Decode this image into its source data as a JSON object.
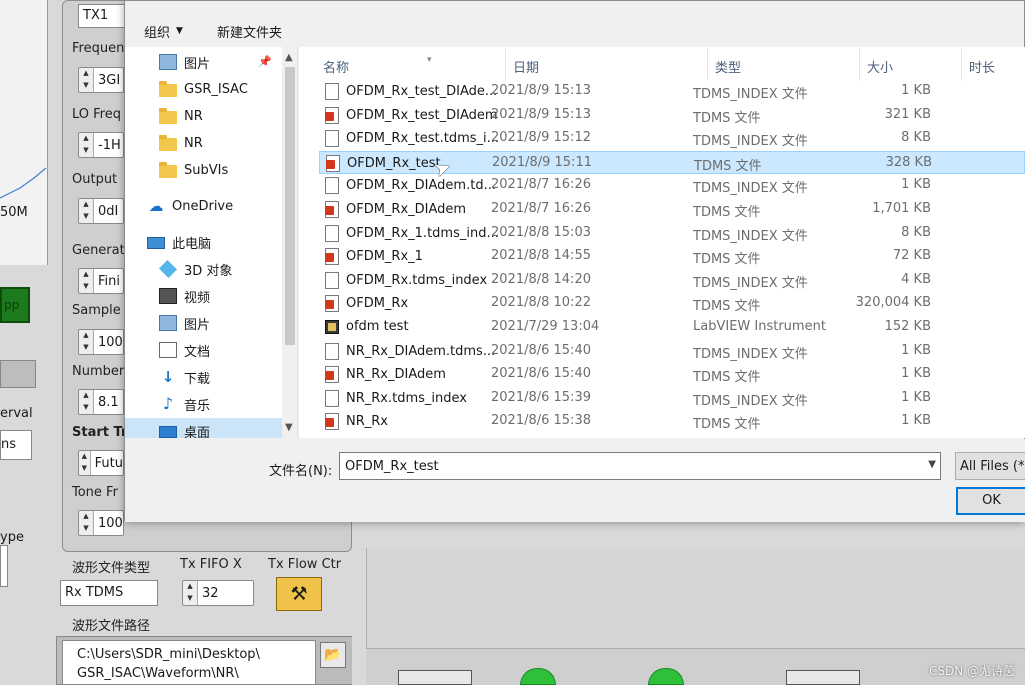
{
  "labview": {
    "freq_tick": "50M",
    "tx_value": "TX1",
    "labels": {
      "frequency": "Frequen",
      "lo_freq": "LO Freq",
      "output": "Output",
      "generate": "Generat",
      "sample": "Sample",
      "number": "Number",
      "start_tr": "Start Tr",
      "tone_fr": "Tone Fr",
      "interval": "erval",
      "type": "ype",
      "waveform_type": "波形文件类型",
      "tx_fifo": "Tx FIFO X",
      "tx_flow": "Tx Flow Ctr",
      "waveform_path": "波形文件路径"
    },
    "values": {
      "frequency": "3GI",
      "lo_freq": "-1H",
      "output": "0dI",
      "generate": "Fini",
      "sample": "100",
      "number": "8.1",
      "start_tr": "Futu",
      "tone_fr": "100",
      "ms": "ns",
      "waveform_type": "Rx TDMS",
      "tx_fifo": "32",
      "path_line1": "C:\\Users\\SDR_mini\\Desktop\\",
      "path_line2": "GSR_ISAC\\Waveform\\NR\\"
    },
    "green_label": "pp"
  },
  "dialog": {
    "toolbar": {
      "organize": "组织",
      "new_folder": "新建文件夹"
    },
    "nav": [
      {
        "label": "图片",
        "icon": "image-icon",
        "pinned": true
      },
      {
        "label": "GSR_ISAC",
        "icon": "folder-icon"
      },
      {
        "label": "NR",
        "icon": "folder-icon"
      },
      {
        "label": "NR",
        "icon": "folder-icon"
      },
      {
        "label": "SubVIs",
        "icon": "folder-icon"
      },
      {
        "label": "OneDrive",
        "icon": "cloud-icon"
      },
      {
        "label": "此电脑",
        "icon": "computer-icon"
      },
      {
        "label": "3D 对象",
        "icon": "3d-objects-icon"
      },
      {
        "label": "视频",
        "icon": "video-icon"
      },
      {
        "label": "图片",
        "icon": "image-icon"
      },
      {
        "label": "文档",
        "icon": "document-icon"
      },
      {
        "label": "下载",
        "icon": "download-icon"
      },
      {
        "label": "音乐",
        "icon": "music-icon"
      },
      {
        "label": "桌面",
        "icon": "desktop-icon"
      }
    ],
    "columns": {
      "name": "名称",
      "date": "日期",
      "type": "类型",
      "size": "大小",
      "duration": "时长"
    },
    "files": [
      {
        "name": "OFDM_Rx_test_DIAde...",
        "date": "2021/8/9 15:13",
        "type": "TDMS_INDEX 文件",
        "size": "1 KB",
        "icon": "index"
      },
      {
        "name": "OFDM_Rx_test_DIAdem",
        "date": "2021/8/9 15:13",
        "type": "TDMS 文件",
        "size": "321 KB",
        "icon": "tdms"
      },
      {
        "name": "OFDM_Rx_test.tdms_i...",
        "date": "2021/8/9 15:12",
        "type": "TDMS_INDEX 文件",
        "size": "8 KB",
        "icon": "index"
      },
      {
        "name": "OFDM_Rx_test",
        "date": "2021/8/9 15:11",
        "type": "TDMS 文件",
        "size": "328 KB",
        "icon": "tdms",
        "selected": true
      },
      {
        "name": "OFDM_Rx_DIAdem.td...",
        "date": "2021/8/7 16:26",
        "type": "TDMS_INDEX 文件",
        "size": "1 KB",
        "icon": "index"
      },
      {
        "name": "OFDM_Rx_DIAdem",
        "date": "2021/8/7 16:26",
        "type": "TDMS 文件",
        "size": "1,701 KB",
        "icon": "tdms"
      },
      {
        "name": "OFDM_Rx_1.tdms_ind...",
        "date": "2021/8/8 15:03",
        "type": "TDMS_INDEX 文件",
        "size": "8 KB",
        "icon": "index"
      },
      {
        "name": "OFDM_Rx_1",
        "date": "2021/8/8 14:55",
        "type": "TDMS 文件",
        "size": "72 KB",
        "icon": "tdms"
      },
      {
        "name": "OFDM_Rx.tdms_index",
        "date": "2021/8/8 14:20",
        "type": "TDMS_INDEX 文件",
        "size": "4 KB",
        "icon": "index"
      },
      {
        "name": "OFDM_Rx",
        "date": "2021/8/8 10:22",
        "type": "TDMS 文件",
        "size": "320,004 KB",
        "icon": "tdms"
      },
      {
        "name": "ofdm test",
        "date": "2021/7/29 13:04",
        "type": "LabVIEW Instrument",
        "size": "152 KB",
        "icon": "vi"
      },
      {
        "name": "NR_Rx_DIAdem.tdms...",
        "date": "2021/8/6 15:40",
        "type": "TDMS_INDEX 文件",
        "size": "1 KB",
        "icon": "index"
      },
      {
        "name": "NR_Rx_DIAdem",
        "date": "2021/8/6 15:40",
        "type": "TDMS 文件",
        "size": "1 KB",
        "icon": "tdms"
      },
      {
        "name": "NR_Rx.tdms_index",
        "date": "2021/8/6 15:39",
        "type": "TDMS_INDEX 文件",
        "size": "1 KB",
        "icon": "index"
      },
      {
        "name": "NR_Rx",
        "date": "2021/8/6 15:38",
        "type": "TDMS 文件",
        "size": "1 KB",
        "icon": "tdms"
      }
    ],
    "footer": {
      "filename_label": "文件名(N):",
      "filename_value": "OFDM_Rx_test",
      "filter": "All Files (*.*)",
      "ok": "OK"
    }
  },
  "watermark": "CSDN @尤诗茵"
}
